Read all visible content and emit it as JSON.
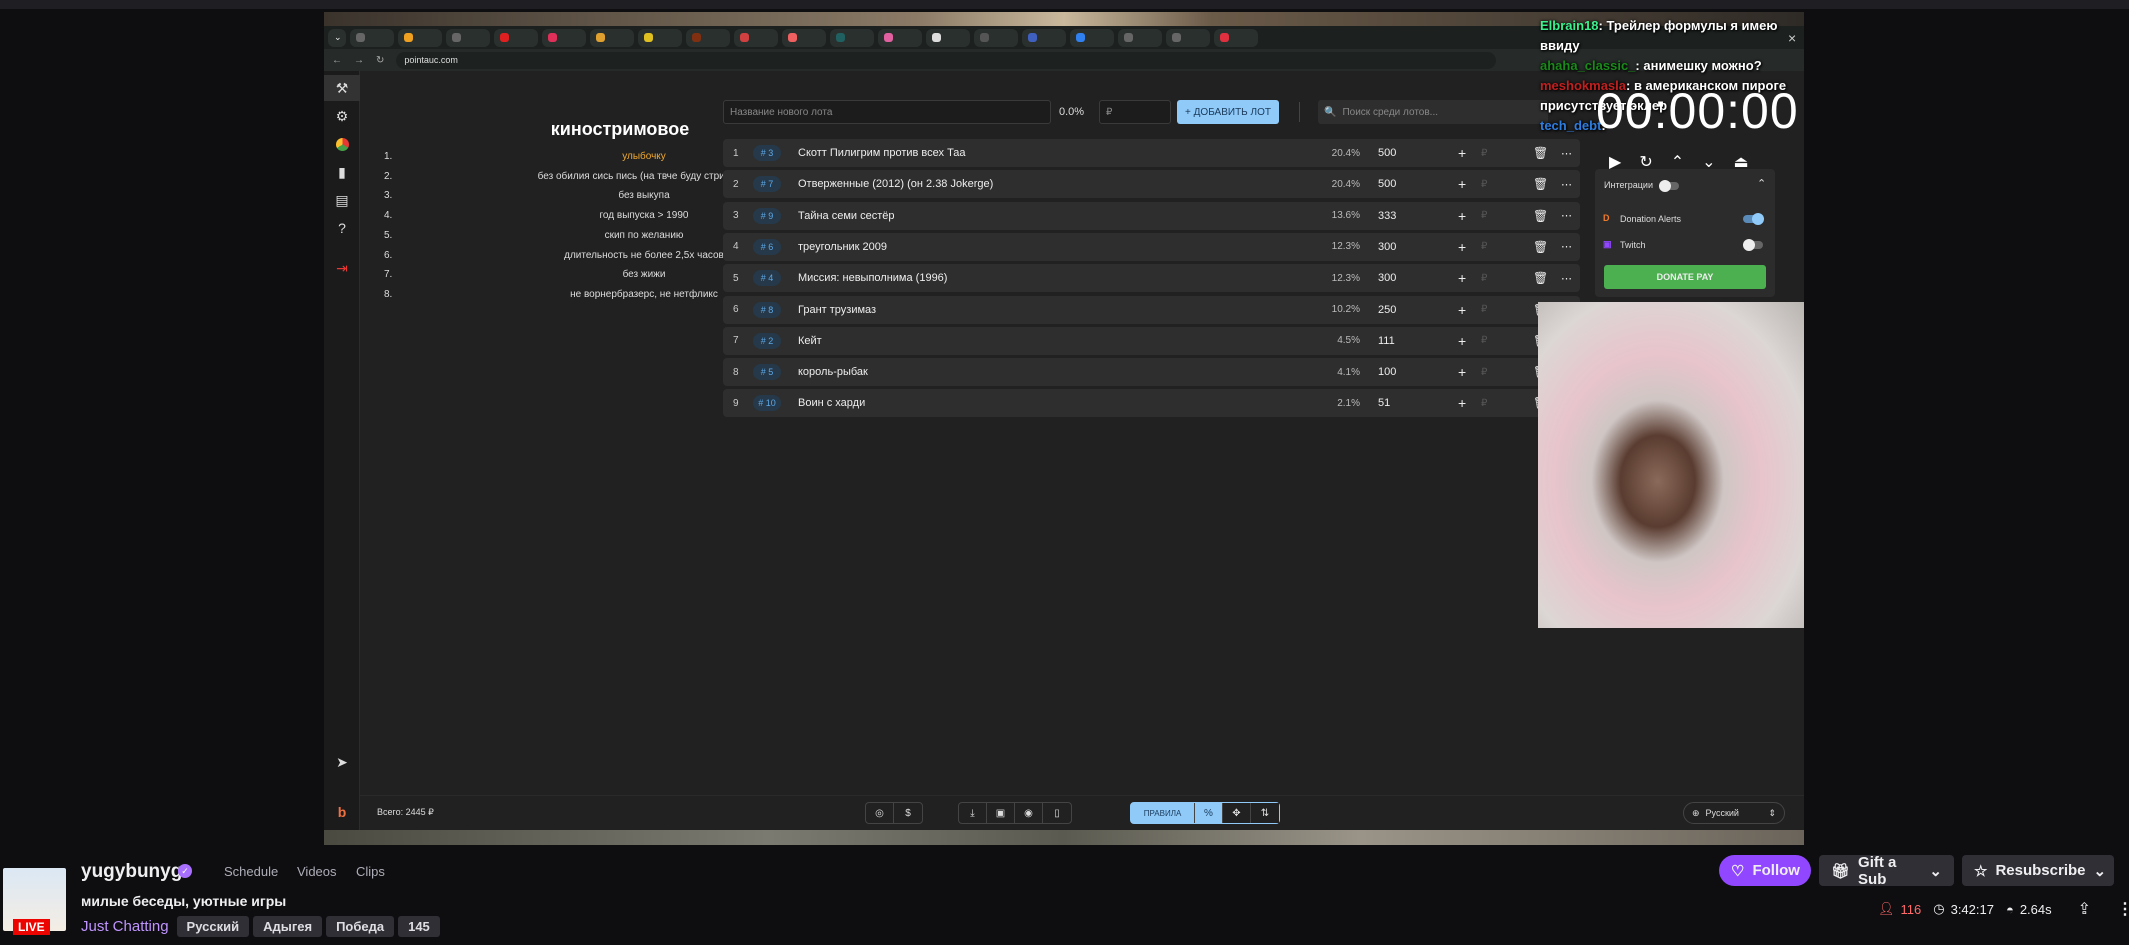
{
  "browser": {
    "url": "pointauc.com"
  },
  "rules": {
    "title": "киностримовое",
    "items": [
      {
        "n": "1.",
        "t": "улыбочку"
      },
      {
        "n": "2.",
        "t": "без обилия сись пись (на твче буду стримить)"
      },
      {
        "n": "3.",
        "t": "без выкупа"
      },
      {
        "n": "4.",
        "t": "год выпуска > 1990"
      },
      {
        "n": "5.",
        "t": "скип по желанию"
      },
      {
        "n": "6.",
        "t": "длительность не более 2,5х часов"
      },
      {
        "n": "7.",
        "t": "без жижи"
      },
      {
        "n": "8.",
        "t": "не ворнербразерс, не нетфликс"
      }
    ]
  },
  "toolbar": {
    "name_placeholder": "Название нового лота",
    "percent": "0.0%",
    "amount_placeholder": "₽",
    "add_label": "+ ДОБАВИТЬ ЛОТ",
    "search_placeholder": "Поиск среди лотов..."
  },
  "lots": [
    {
      "i": "1",
      "id": "# 3",
      "name": "Скотт Пилигрим против всех Таа",
      "pct": "20.4%",
      "amt": "500"
    },
    {
      "i": "2",
      "id": "# 7",
      "name": "Отверженные (2012) (он 2.38 Jokerge)",
      "pct": "20.4%",
      "amt": "500"
    },
    {
      "i": "3",
      "id": "# 9",
      "name": "Тайна семи сестёр",
      "pct": "13.6%",
      "amt": "333"
    },
    {
      "i": "4",
      "id": "# 6",
      "name": "треугольник 2009",
      "pct": "12.3%",
      "amt": "300"
    },
    {
      "i": "5",
      "id": "# 4",
      "name": "Миссия: невыполнима (1996)",
      "pct": "12.3%",
      "amt": "300"
    },
    {
      "i": "6",
      "id": "# 8",
      "name": "Грант трузимаз",
      "pct": "10.2%",
      "amt": "250"
    },
    {
      "i": "7",
      "id": "# 2",
      "name": "Кейт",
      "pct": "4.5%",
      "amt": "111"
    },
    {
      "i": "8",
      "id": "# 5",
      "name": "король-рыбак",
      "pct": "4.1%",
      "amt": "100"
    },
    {
      "i": "9",
      "id": "# 10",
      "name": "Воин с харди",
      "pct": "2.1%",
      "amt": "51"
    }
  ],
  "chat": [
    {
      "user": "Elbrain18",
      "color": "#3cf08c",
      "text": "Трейлер формулы я имею ввиду"
    },
    {
      "user": "ahaha_classic_",
      "color": "#1a8a1a",
      "text": "анимешку можно?"
    },
    {
      "user": "meshokmasla",
      "color": "#c02020",
      "text": "в американском пироге присутствует эклер"
    },
    {
      "user": "tech_debt",
      "color": "#2e7de0",
      "text": ""
    }
  ],
  "timer": "00:00:00",
  "integrations": {
    "label": "Интеграции",
    "donation_alerts": "Donation Alerts",
    "twitch": "Twitch",
    "donate_pay": "DONATE PAY"
  },
  "footer": {
    "total": "Всего: 2445 ₽",
    "rules_label": "ПРАВИЛА",
    "language": "Русский"
  },
  "channel": {
    "name": "yugybunyg",
    "live": "LIVE",
    "nav": [
      "Schedule",
      "Videos",
      "Clips"
    ],
    "title": "милые беседы, уютные игры",
    "category": "Just Chatting",
    "tags": [
      "Русский",
      "Адыгея",
      "Победа",
      "145"
    ]
  },
  "actions": {
    "follow": "Follow",
    "gift": "Gift a Sub",
    "resub": "Resubscribe"
  },
  "stats": {
    "viewers": "116",
    "uptime": "3:42:17",
    "latency": "2.64s"
  },
  "colors": {
    "accent": "#9147ff",
    "live": "#eb0400",
    "viewers": "#ff6b6b"
  }
}
